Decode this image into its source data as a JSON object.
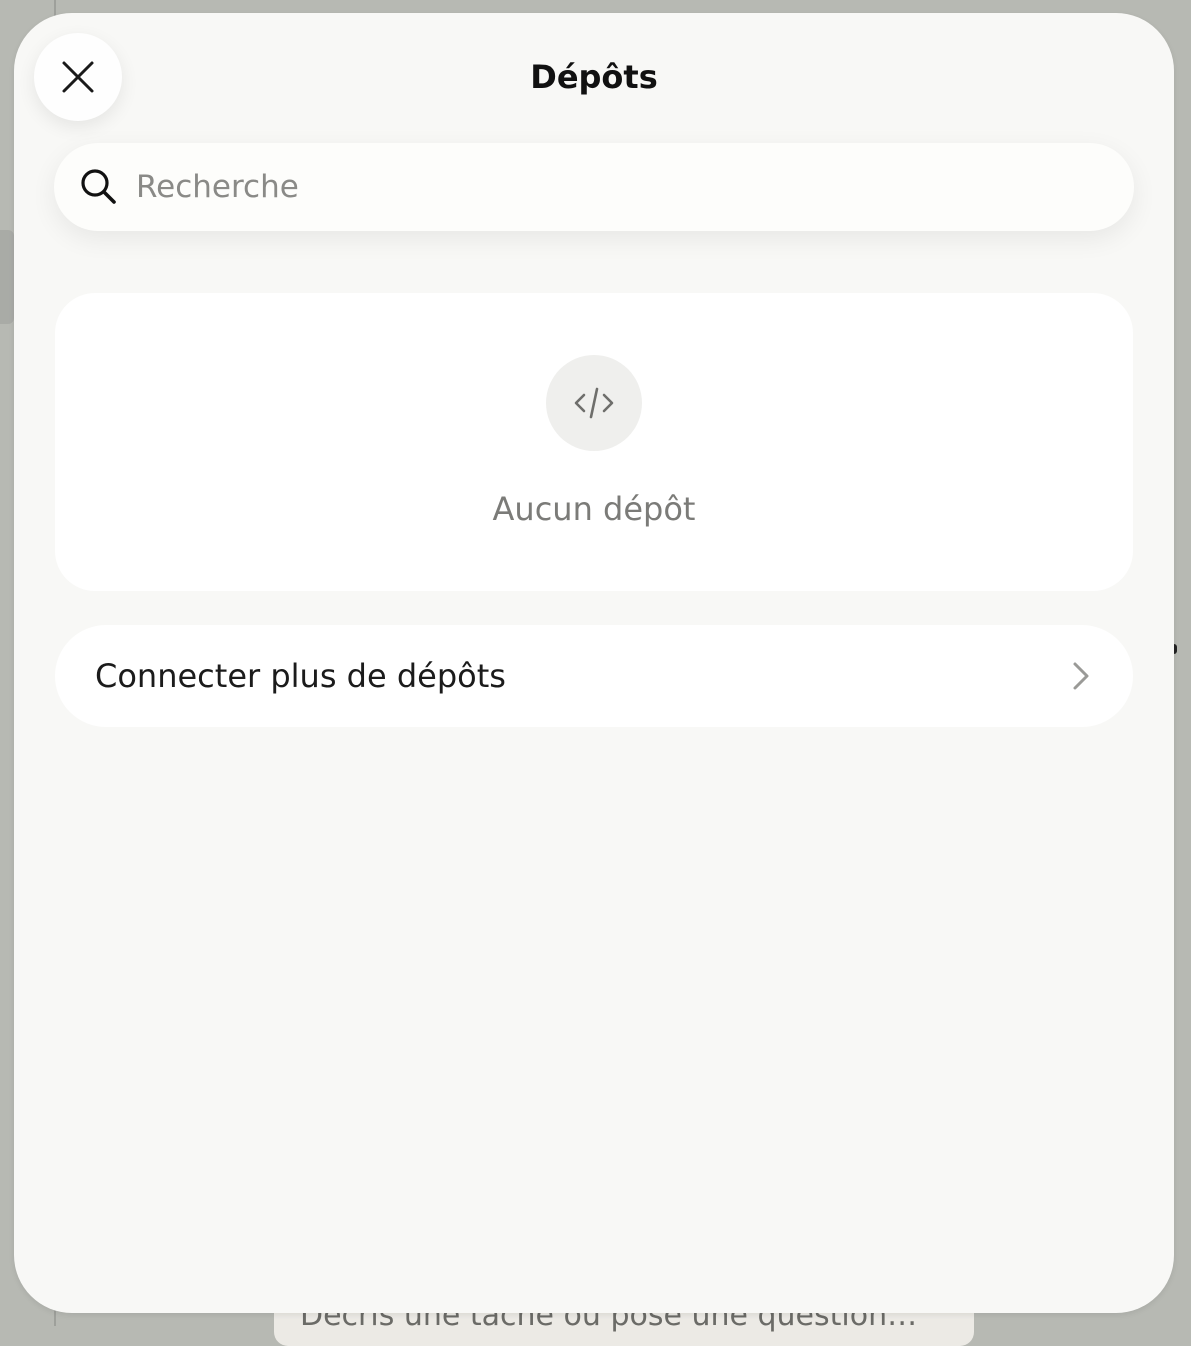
{
  "background": {
    "prompt_placeholder": "Décris une tâche ou pose une question…"
  },
  "sheet": {
    "title": "Dépôts",
    "close_icon": "close-icon"
  },
  "search": {
    "placeholder": "Recherche",
    "value": "",
    "icon": "search-icon"
  },
  "empty_state": {
    "icon": "code-icon",
    "message": "Aucun dépôt"
  },
  "connect": {
    "label": "Connecter plus de dépôts",
    "icon": "chevron-right-icon"
  },
  "colors": {
    "sheet_background": "#f8f8f6",
    "card_background": "#ffffff",
    "muted_text": "#7b7b78",
    "title_text": "#111111"
  }
}
